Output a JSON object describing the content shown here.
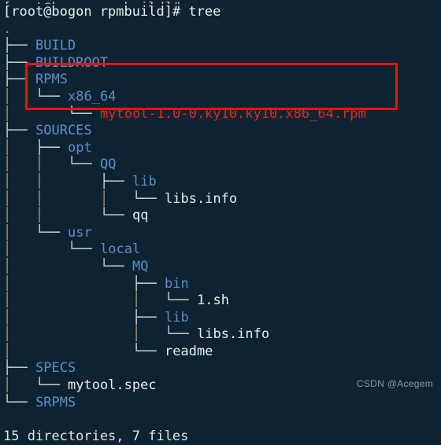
{
  "terminal": {
    "top_partial_line": "[root@bogon rpmbuild]#",
    "prompt_line": "[root@bogon rpmbuild]# tree",
    "root_label": ".",
    "summary": "15 directories, 7 files",
    "cursor": "",
    "colors": {
      "background": "#0d2331",
      "directory": "#5c8ecb",
      "file": "#e6edef",
      "rpm_highlight": "#e02b20",
      "prompt_text": "#e8eef0",
      "tree_stem": "#b9925f",
      "tree_bar": "#cfd8dc",
      "annotation_box": "#ee1111",
      "watermark": "#8d9ba2"
    }
  },
  "tree": {
    "lines": [
      {
        "prefix": "├── ",
        "name": "BUILD",
        "type": "dir"
      },
      {
        "prefix": "├── ",
        "name": "BUILDROOT",
        "type": "dir"
      },
      {
        "prefix": "├── ",
        "name": "RPMS",
        "type": "dir"
      },
      {
        "prefix": "│   └── ",
        "name": "x86_64",
        "type": "dir"
      },
      {
        "prefix": "│       └── ",
        "name": "mytool-1.0-0.ky10.ky10.x86_64.rpm",
        "type": "rpm"
      },
      {
        "prefix": "├── ",
        "name": "SOURCES",
        "type": "dir"
      },
      {
        "prefix": "│   ├── ",
        "name": "opt",
        "type": "dir"
      },
      {
        "prefix": "│   │   └── ",
        "name": "QQ",
        "type": "dir"
      },
      {
        "prefix": "│   │       ├── ",
        "name": "lib",
        "type": "dir"
      },
      {
        "prefix": "│   │       │   └── ",
        "name": "libs.info",
        "type": "file"
      },
      {
        "prefix": "│   │       └── ",
        "name": "qq",
        "type": "file"
      },
      {
        "prefix": "│   └── ",
        "name": "usr",
        "type": "dir"
      },
      {
        "prefix": "│       └── ",
        "name": "local",
        "type": "dir"
      },
      {
        "prefix": "│           └── ",
        "name": "MQ",
        "type": "dir"
      },
      {
        "prefix": "│               ├── ",
        "name": "bin",
        "type": "dir"
      },
      {
        "prefix": "│               │   └── ",
        "name": "1.sh",
        "type": "file"
      },
      {
        "prefix": "│               ├── ",
        "name": "lib",
        "type": "dir"
      },
      {
        "prefix": "│               │   └── ",
        "name": "libs.info",
        "type": "file"
      },
      {
        "prefix": "│               └── ",
        "name": "readme",
        "type": "file"
      },
      {
        "prefix": "├── ",
        "name": "SPECS",
        "type": "dir"
      },
      {
        "prefix": "│   └── ",
        "name": "mytool.spec",
        "type": "file"
      },
      {
        "prefix": "└── ",
        "name": "SRPMS",
        "type": "dir"
      }
    ]
  },
  "annotation": {
    "label": "red-rectangle-highlight",
    "targets": [
      "RPMS",
      "x86_64",
      "mytool-1.0-0.ky10.ky10.x86_64.rpm"
    ]
  },
  "watermark": {
    "text": "CSDN @Acegem"
  }
}
